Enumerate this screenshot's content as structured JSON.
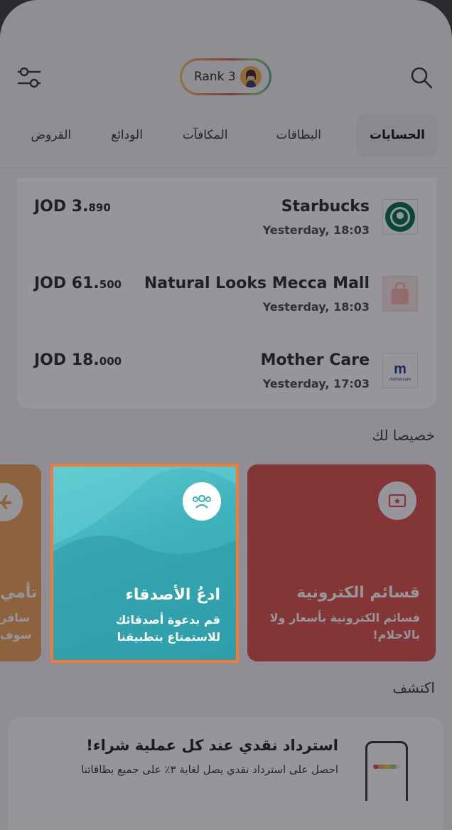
{
  "header": {
    "rank_label": "Rank 3",
    "filter_icon": "sliders-icon",
    "search_icon": "search-icon"
  },
  "tabs": [
    {
      "label": "الحسابات",
      "active": true
    },
    {
      "label": "البطاقات",
      "active": false
    },
    {
      "label": "المكافآت",
      "active": false
    },
    {
      "label": "الودائع",
      "active": false
    },
    {
      "label": "القروض",
      "active": false
    }
  ],
  "transactions": [
    {
      "merchant": "Starbucks",
      "time": "Yesterday, 18:03",
      "currency_int": "JOD 3.",
      "decimals": "890",
      "logo": "starbucks-logo"
    },
    {
      "merchant": "Natural Looks Mecca Mall",
      "time": "Yesterday, 18:03",
      "currency_int": "JOD 61.",
      "decimals": "500",
      "logo": "shopping-bag-logo"
    },
    {
      "merchant": "Mother Care",
      "time": "Yesterday, 17:03",
      "currency_int": "JOD 18.",
      "decimals": "000",
      "logo": "mothercare-logo"
    }
  ],
  "for_you": {
    "title": "خصيصا لك",
    "offers": [
      {
        "title": "تأمي",
        "desc": "سافر\nسوف",
        "icon": "airplane-icon",
        "color": "#f0a35a"
      },
      {
        "title": "ادعُ الأصدقاء",
        "desc": "قم بدعوة أصدقائك\nللاستمتاع بتطبيقنا",
        "icon": "friends-icon",
        "color": "#3fb3bd",
        "highlighted": true
      },
      {
        "title": "قسائم الكترونية",
        "desc": "قسائم الكترونية بأسعار ولا\nبالاحلام!",
        "icon": "voucher-icon",
        "color": "#e0524a"
      }
    ]
  },
  "discover": {
    "title": "اكتشف",
    "card_title": "استرداد نقدي عند كل عملية شراء!",
    "card_desc": "احصل على استرداد نقدي يصل لغاية ٣٪ على جميع بطاقاتنا"
  },
  "colors": {
    "highlight_border": "#f47a3a",
    "teal": "#3fb3bd",
    "red": "#e0524a",
    "orange": "#f0a35a"
  }
}
